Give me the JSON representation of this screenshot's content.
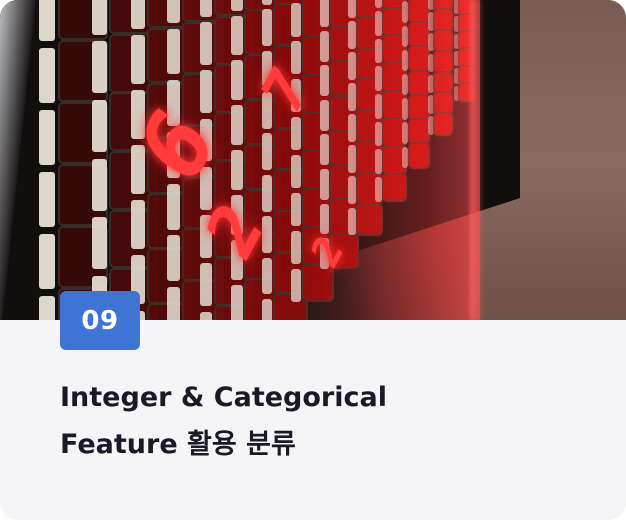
{
  "card": {
    "badge_number": "09",
    "title_line1": "Integer & Categorical",
    "title_line2": "Feature 활용 분류",
    "accent_color": "#3f74d4",
    "title_color": "#181a26",
    "background_color": "#f5f5f7"
  },
  "hero_image": {
    "digits_visible": [
      "6",
      "7",
      "2",
      "2"
    ]
  }
}
